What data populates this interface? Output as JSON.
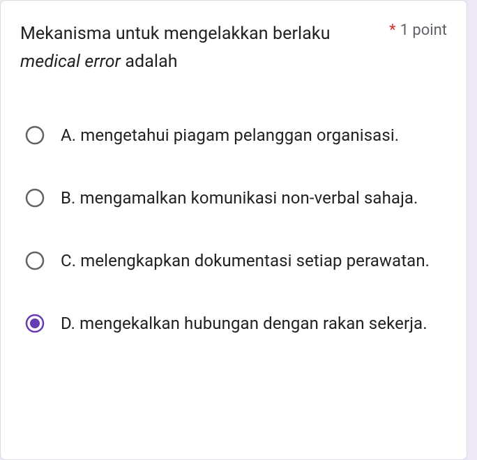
{
  "question": {
    "text_pre": "Mekanisma untuk mengelakkan berlaku ",
    "text_italic": "medical error",
    "text_post": " adalah",
    "required_mark": "*",
    "points_label": "1 point"
  },
  "options": [
    {
      "label": "A. mengetahui piagam pelanggan organisasi.",
      "selected": false
    },
    {
      "label": "B. mengamalkan komunikasi non-verbal sahaja.",
      "selected": false
    },
    {
      "label": "C. melengkapkan dokumentasi setiap perawatan.",
      "selected": false
    },
    {
      "label": "D. mengekalkan hubungan dengan rakan sekerja.",
      "selected": true
    }
  ]
}
